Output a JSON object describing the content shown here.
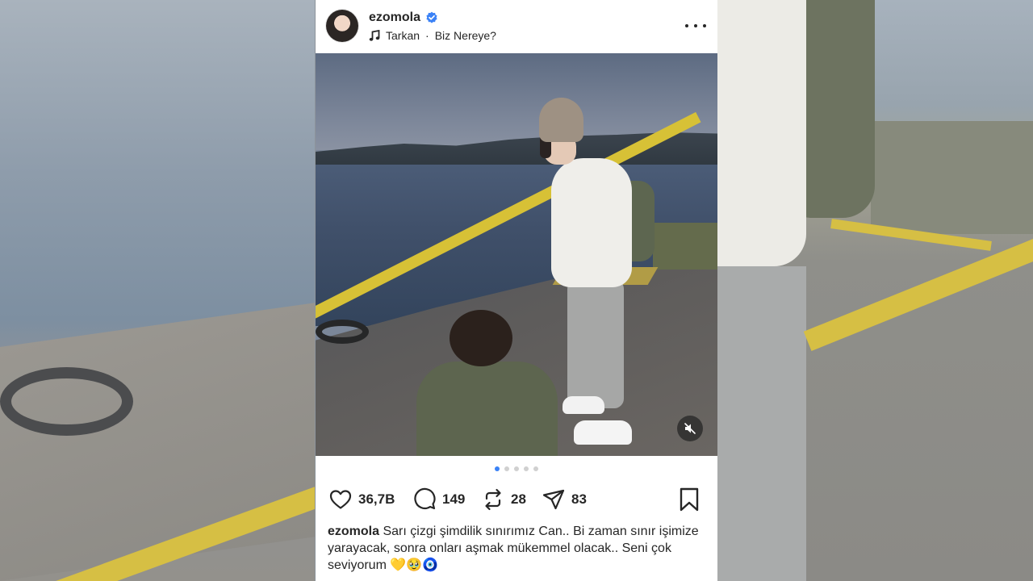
{
  "post": {
    "username": "ezomola",
    "music": {
      "artist": "Tarkan",
      "separator": "·",
      "song": "Biz Nereye?"
    },
    "photo": {
      "carousel_total": 5,
      "carousel_active_index": 0
    },
    "actions": {
      "likes": "36,7B",
      "comments": "149",
      "reposts": "28",
      "shares": "83"
    },
    "caption": {
      "username": "ezomola",
      "text": "Sarı çizgi şimdilik sınırımız Can.. Bi zaman sınır işimize yarayacak, sonra onları aşmak mükemmel olacak.. Seni çok seviyorum 💛🥹🧿"
    }
  },
  "colors": {
    "verified_blue": "#3b82f6",
    "active_dot": "#3b82f6",
    "text": "#262626"
  },
  "icons": {
    "more": "more-horizontal-icon",
    "music": "music-note-icon",
    "like": "heart-icon",
    "comment": "comment-bubble-icon",
    "repost": "repost-icon",
    "share": "send-icon",
    "save": "bookmark-icon",
    "mute": "speaker-muted-icon"
  }
}
